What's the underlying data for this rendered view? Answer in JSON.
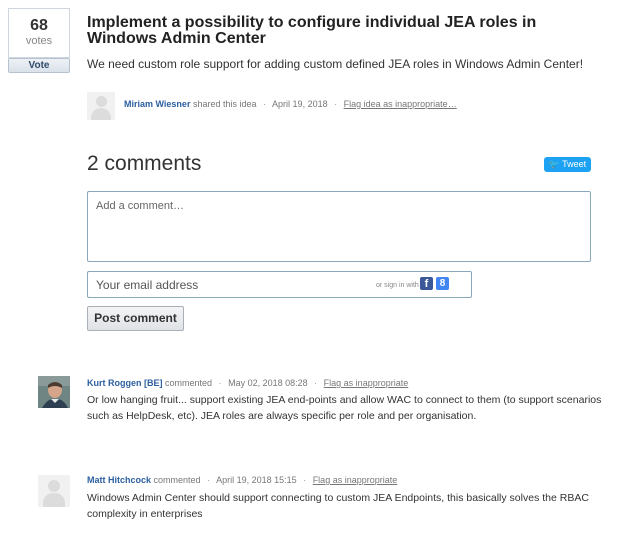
{
  "idea": {
    "votes_count": "68",
    "votes_label": "votes",
    "vote_button": "Vote",
    "title": "Implement a possibility to configure individual JEA roles in Windows Admin Center",
    "description": "We need custom role support for adding custom defined JEA roles in Windows Admin Center!",
    "author": "Miriam Wiesner",
    "shared_text": "shared this idea",
    "date": "April 19, 2018",
    "flag_link": "Flag idea as inappropriate…"
  },
  "comments_section": {
    "heading": "2 comments",
    "tweet_label": "Tweet",
    "comment_placeholder": "Add a comment…",
    "email_placeholder": "Your email address",
    "signin_text": "or sign in with",
    "facebook_glyph": "f",
    "google_glyph": "8",
    "post_button": "Post comment"
  },
  "comments": [
    {
      "author": "Kurt Roggen [BE]",
      "action": "commented",
      "date": "May 02, 2018 08:28",
      "flag_link": "Flag as inappropriate",
      "text": "Or low hanging fruit... support existing JEA end-points and allow WAC to connect to them (to support scenarios such as HelpDesk, etc). JEA roles are always specific per role and per organisation."
    },
    {
      "author": "Matt Hitchcock",
      "action": "commented",
      "date": "April 19, 2018 15:15",
      "flag_link": "Flag as inappropriate",
      "text": "Windows Admin Center should support connecting to custom JEA Endpoints, this basically solves the RBAC complexity in enterprises"
    }
  ],
  "colors": {
    "link_blue": "#2c5fa0",
    "tweet_blue": "#1da1f2",
    "facebook_blue": "#3b5998",
    "input_border": "#8aa8bd"
  }
}
